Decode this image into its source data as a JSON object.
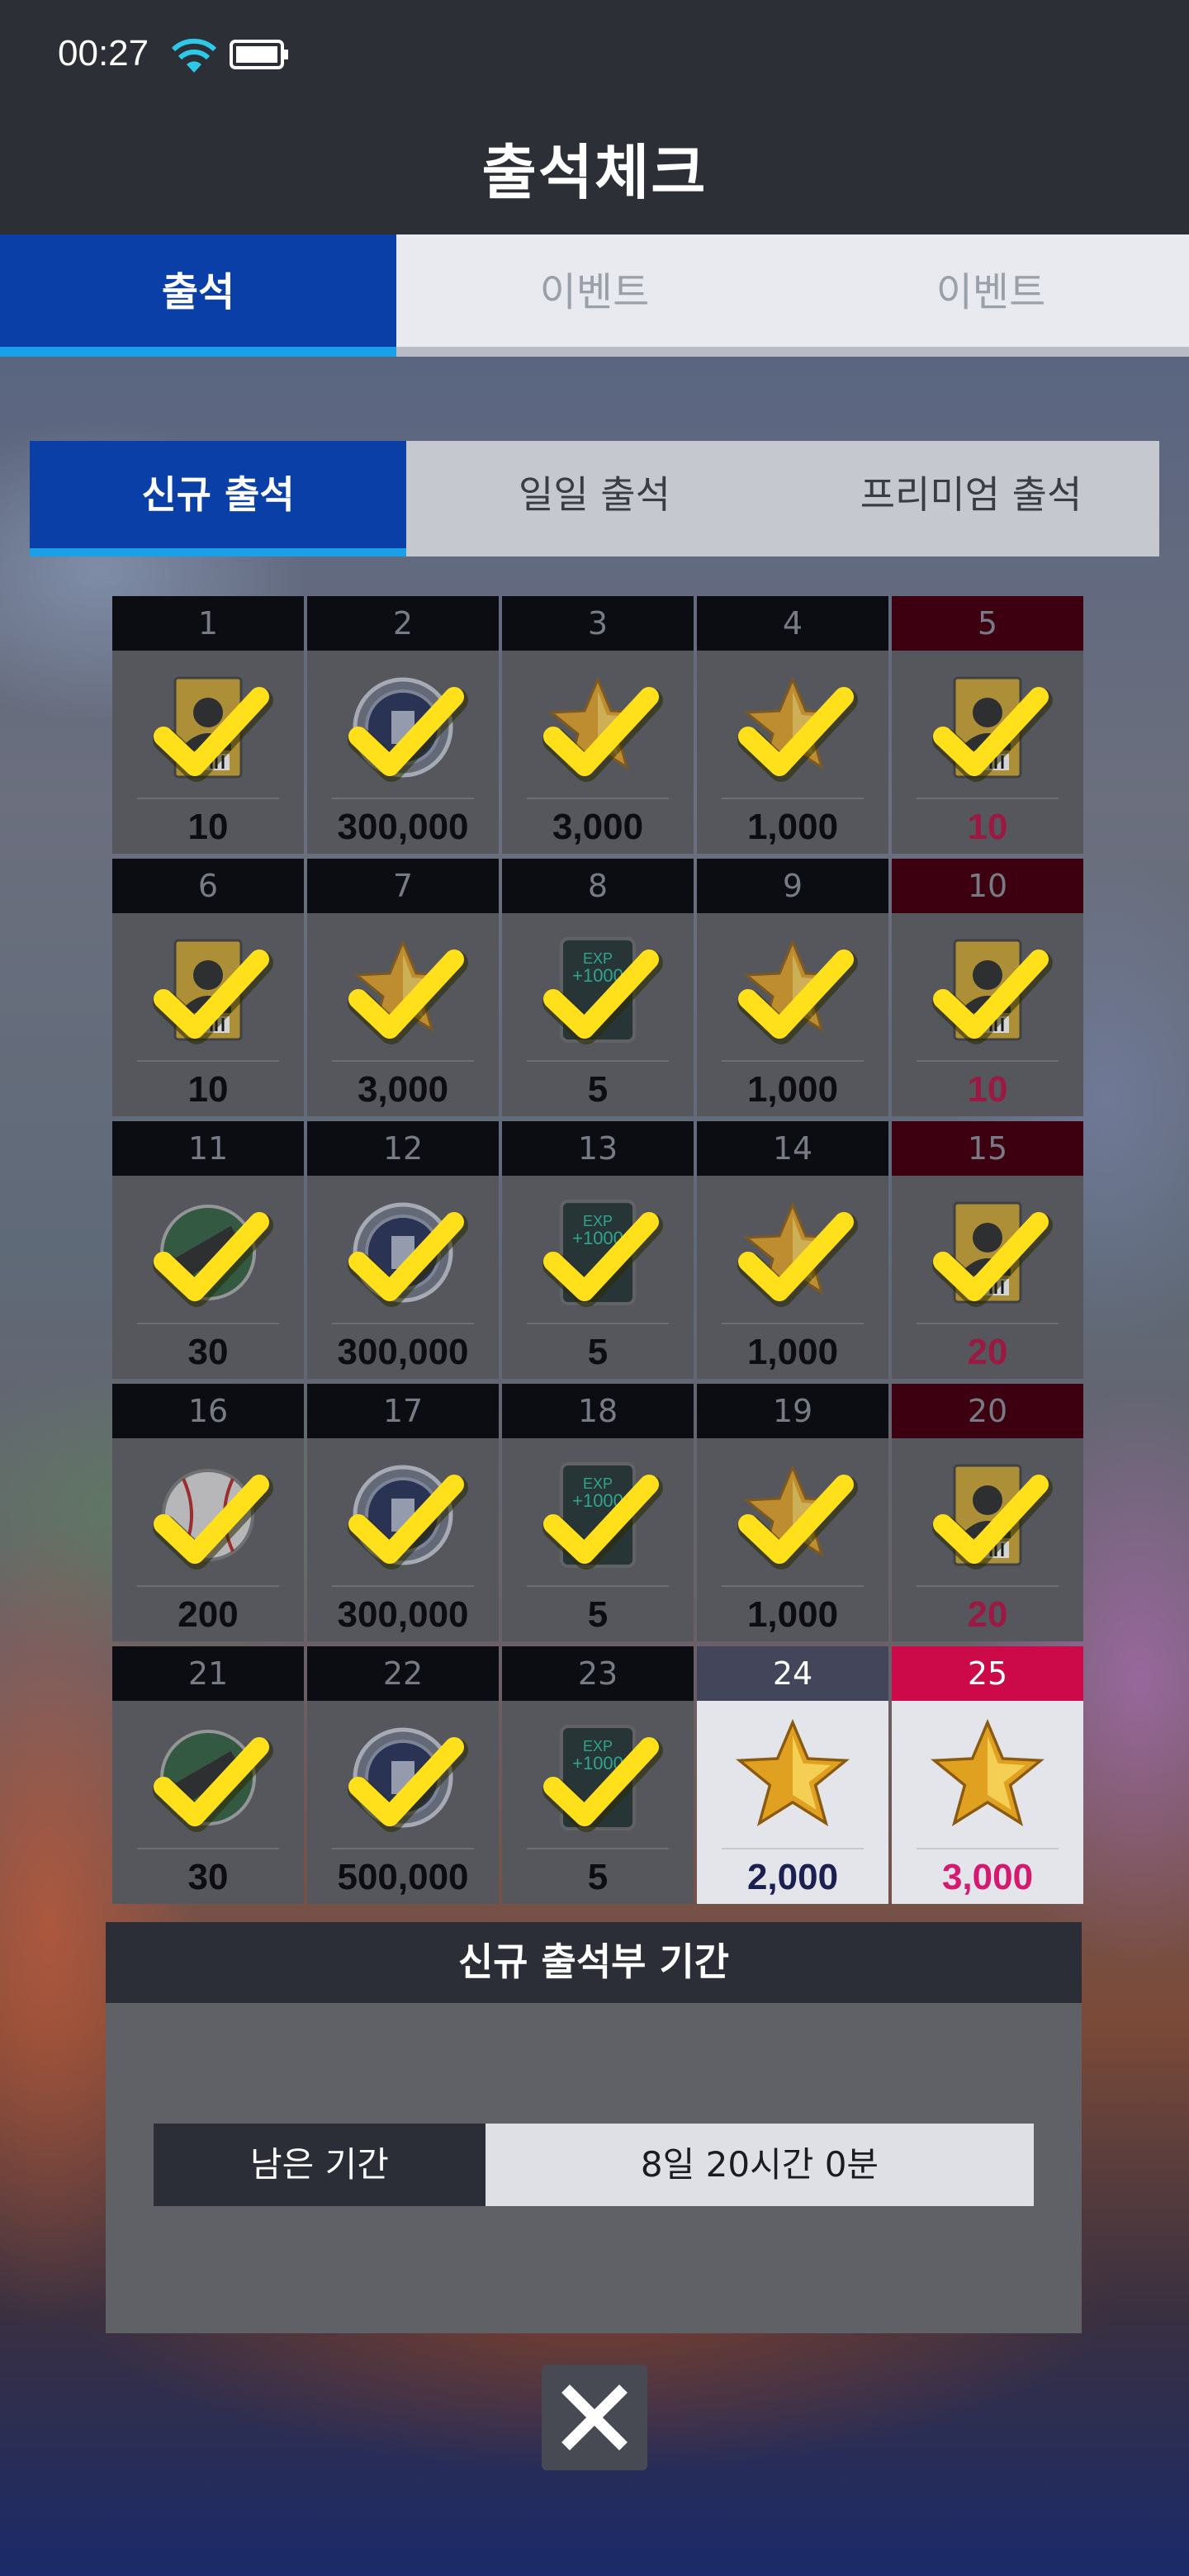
{
  "status": {
    "time": "00:27"
  },
  "title": "출석체크",
  "top_tabs": [
    "출석",
    "이벤트",
    "이벤트"
  ],
  "sub_tabs": [
    "신규 출석",
    "일일 출석",
    "프리미엄 출석"
  ],
  "days": [
    {
      "day": "1",
      "amount": "10",
      "reward": "player-card-icon",
      "checked": true,
      "bonus": false
    },
    {
      "day": "2",
      "amount": "300,000",
      "reward": "coin-icon",
      "checked": true,
      "bonus": false
    },
    {
      "day": "3",
      "amount": "3,000",
      "reward": "star-icon",
      "checked": true,
      "bonus": false
    },
    {
      "day": "4",
      "amount": "1,000",
      "reward": "star-icon",
      "checked": true,
      "bonus": false
    },
    {
      "day": "5",
      "amount": "10",
      "reward": "player-card-icon",
      "checked": true,
      "bonus": true
    },
    {
      "day": "6",
      "amount": "10",
      "reward": "player-card-icon",
      "checked": true,
      "bonus": false
    },
    {
      "day": "7",
      "amount": "3,000",
      "reward": "star-icon",
      "checked": true,
      "bonus": false
    },
    {
      "day": "8",
      "amount": "5",
      "reward": "exp-card-icon",
      "checked": true,
      "bonus": false
    },
    {
      "day": "9",
      "amount": "1,000",
      "reward": "star-icon",
      "checked": true,
      "bonus": false
    },
    {
      "day": "10",
      "amount": "10",
      "reward": "player-card-icon",
      "checked": true,
      "bonus": true
    },
    {
      "day": "11",
      "amount": "30",
      "reward": "ticket-icon",
      "checked": true,
      "bonus": false
    },
    {
      "day": "12",
      "amount": "300,000",
      "reward": "coin-icon",
      "checked": true,
      "bonus": false
    },
    {
      "day": "13",
      "amount": "5",
      "reward": "exp-card-icon",
      "checked": true,
      "bonus": false
    },
    {
      "day": "14",
      "amount": "1,000",
      "reward": "star-icon",
      "checked": true,
      "bonus": false
    },
    {
      "day": "15",
      "amount": "20",
      "reward": "player-card-icon",
      "checked": true,
      "bonus": true
    },
    {
      "day": "16",
      "amount": "200",
      "reward": "baseball-icon",
      "checked": true,
      "bonus": false
    },
    {
      "day": "17",
      "amount": "300,000",
      "reward": "coin-icon",
      "checked": true,
      "bonus": false
    },
    {
      "day": "18",
      "amount": "5",
      "reward": "exp-card-icon",
      "checked": true,
      "bonus": false
    },
    {
      "day": "19",
      "amount": "1,000",
      "reward": "star-icon",
      "checked": true,
      "bonus": false
    },
    {
      "day": "20",
      "amount": "20",
      "reward": "player-card-icon",
      "checked": true,
      "bonus": true
    },
    {
      "day": "21",
      "amount": "30",
      "reward": "ticket-icon",
      "checked": true,
      "bonus": false
    },
    {
      "day": "22",
      "amount": "500,000",
      "reward": "coin-icon",
      "checked": true,
      "bonus": false
    },
    {
      "day": "23",
      "amount": "5",
      "reward": "exp-card-icon",
      "checked": true,
      "bonus": false
    },
    {
      "day": "24",
      "amount": "2,000",
      "reward": "star-icon",
      "checked": false,
      "bonus": false
    },
    {
      "day": "25",
      "amount": "3,000",
      "reward": "star-icon",
      "checked": false,
      "bonus": true
    }
  ],
  "exp_label": "EXP",
  "exp_value": "+1000",
  "period": {
    "header": "신규 출석부 기간",
    "label": "남은 기간",
    "value": "8일 20시간 0분"
  },
  "colors": {
    "accent_blue": "#0a3fa8",
    "tab_underline": "#1aa0e8",
    "bonus_pink": "#cc0a4a",
    "check_yellow": "#ffe01a"
  }
}
